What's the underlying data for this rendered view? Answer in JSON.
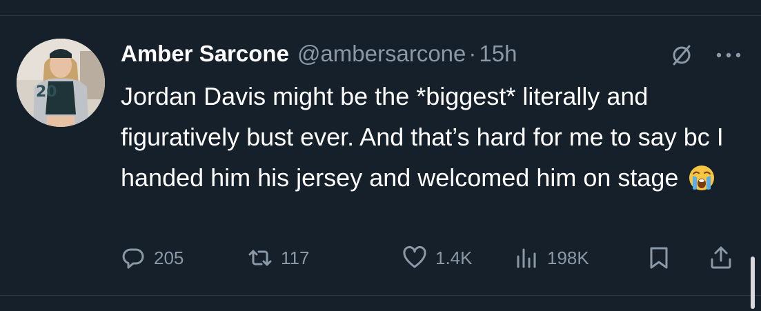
{
  "author": {
    "display_name": "Amber Sarcone",
    "handle": "@ambersarcone",
    "separator": "·",
    "time": "15h"
  },
  "tweet": {
    "text": "Jordan Davis might be the *biggest* literally and figuratively bust ever. And that’s hard for me to say bc I handed him his jersey and welcomed him on stage"
  },
  "avatar": {
    "jersey_number": "20"
  },
  "actions": {
    "replies": "205",
    "retweets": "117",
    "likes": "1.4K",
    "views": "198K"
  },
  "icons": {
    "reply": "reply-icon",
    "retweet": "retweet-icon",
    "like": "heart-icon",
    "views": "views-icon",
    "bookmark": "bookmark-icon",
    "share": "share-icon",
    "hide": "hide-icon",
    "more": "more-icon",
    "emoji": "crying-face-emoji"
  },
  "colors": {
    "background": "#15202b",
    "primary_text": "#ffffff",
    "secondary_text": "#8b98a5"
  }
}
